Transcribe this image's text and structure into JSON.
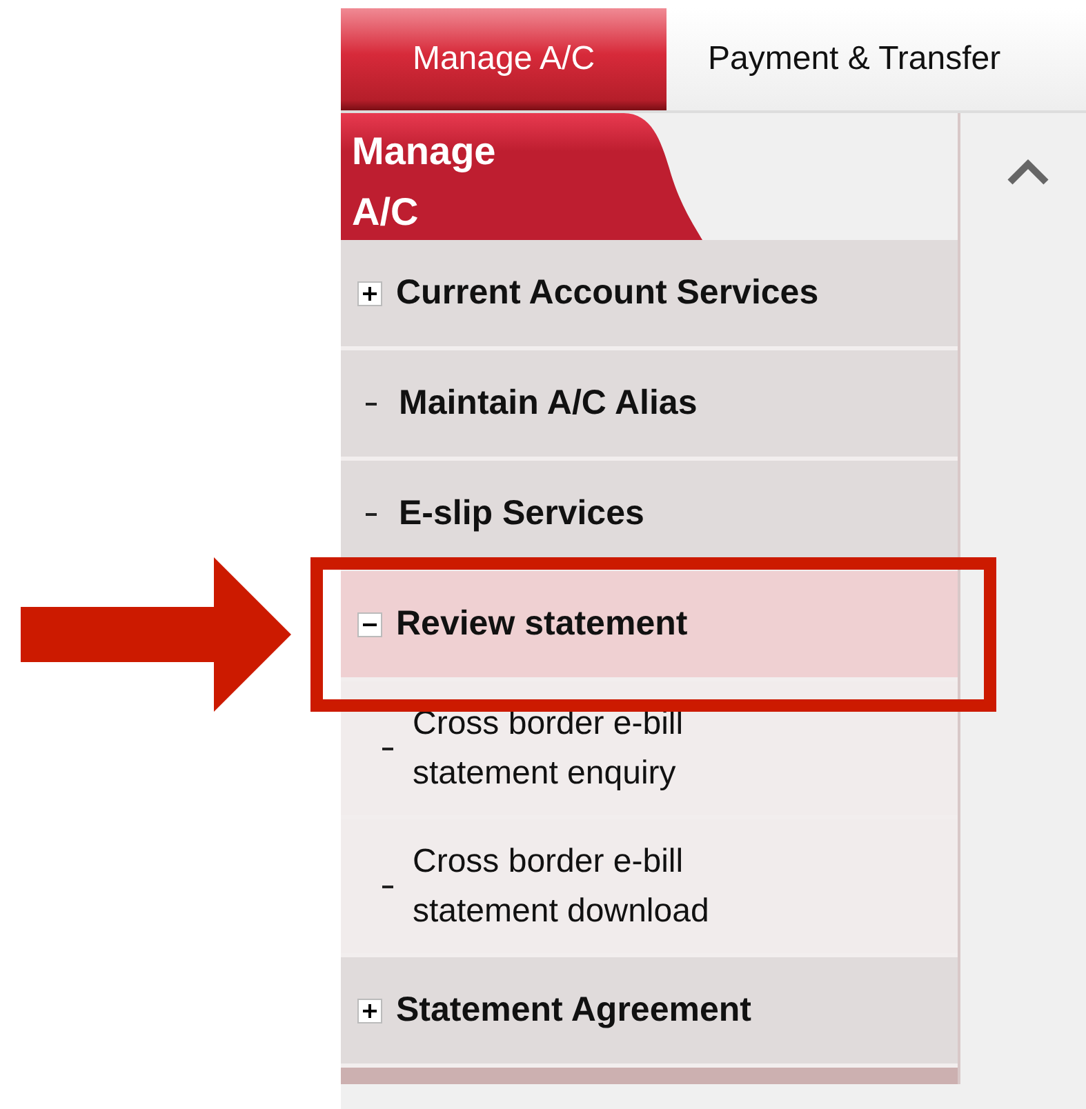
{
  "tabs": [
    {
      "label": "Manage A/C",
      "selected": true
    },
    {
      "label": "Payment & Transfer",
      "selected": false
    }
  ],
  "sidebar": {
    "title": "Manage A/C",
    "items": [
      {
        "label": "Current Account Services",
        "kind": "group",
        "expanded": false,
        "selected": false
      },
      {
        "label": "Maintain A/C Alias",
        "kind": "link",
        "selected": false
      },
      {
        "label": "E-slip Services",
        "kind": "link",
        "selected": false
      },
      {
        "label": "Review statement",
        "kind": "group",
        "expanded": true,
        "selected": true,
        "children": [
          {
            "label": "Cross border e-bill statement enquiry",
            "kind": "link",
            "selected": false
          },
          {
            "label": "Cross border e-bill statement download",
            "kind": "link",
            "selected": false
          }
        ]
      },
      {
        "label": "Statement Agreement",
        "kind": "group",
        "expanded": false,
        "selected": false
      }
    ]
  }
}
